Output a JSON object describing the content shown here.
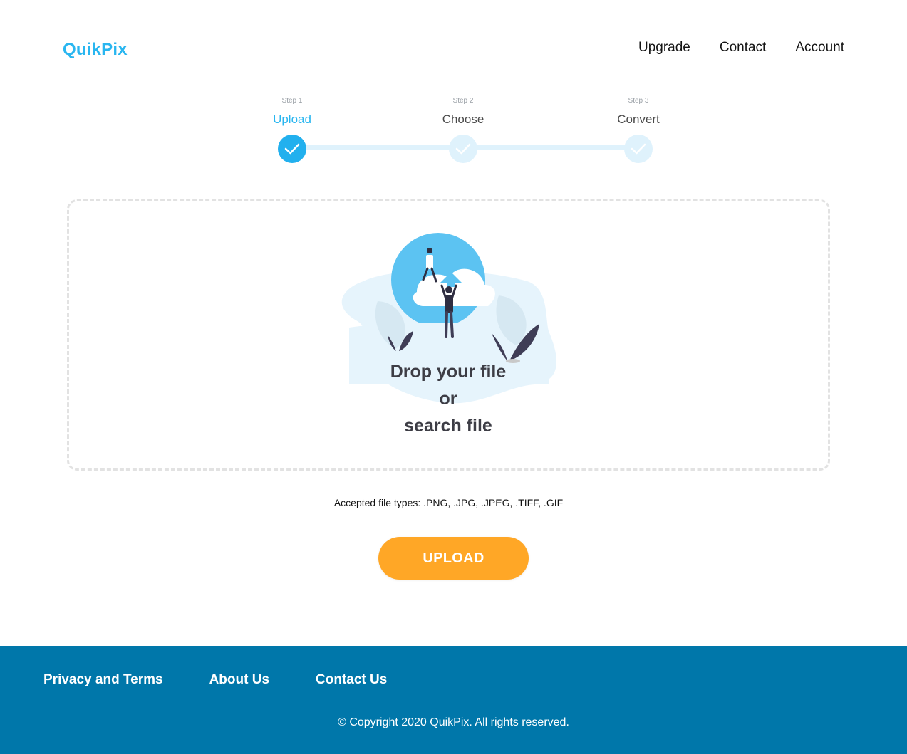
{
  "header": {
    "logo": "QuikPix",
    "nav": [
      "Upgrade",
      "Contact",
      "Account"
    ]
  },
  "steps": [
    {
      "small": "Step 1",
      "title": "Upload",
      "status": "active"
    },
    {
      "small": "Step 2",
      "title": "Choose",
      "status": "pending"
    },
    {
      "small": "Step 3",
      "title": "Convert",
      "status": "pending"
    }
  ],
  "dropzone": {
    "line1": "Drop your file",
    "line2": "or",
    "line3": "search file"
  },
  "accepted": "Accepted file types: .PNG, .JPG, .JPEG, .TIFF, .GIF",
  "upload_button": "UPLOAD",
  "footer": {
    "links": [
      "Privacy and Terms",
      "About Us",
      "Contact Us"
    ],
    "copyright": "© Copyright 2020 QuikPix. All rights reserved."
  },
  "colors": {
    "brand": "#29b6f0",
    "accent": "#ffa726",
    "footer": "#0077aa",
    "step_inactive": "#dff2fc"
  }
}
